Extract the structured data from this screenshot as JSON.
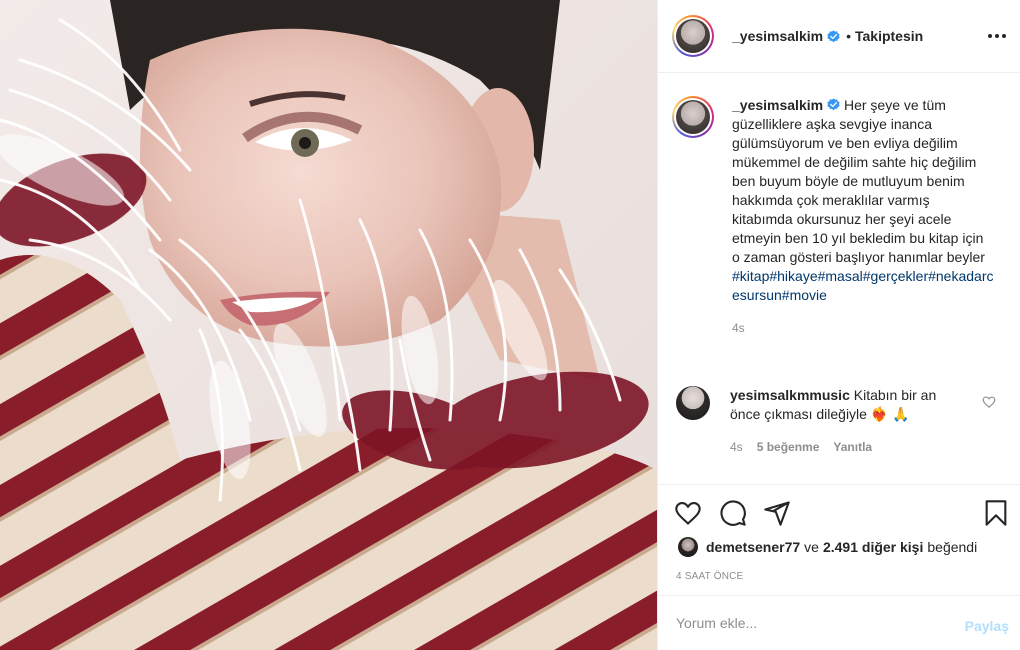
{
  "post": {
    "username": "_yesimsalkim",
    "follow_separator": "•",
    "follow_status": "Takiptesin",
    "more_icon": "more-horizontal-icon"
  },
  "caption": {
    "username": "_yesimsalkim",
    "text": "Her şeye ve tüm güzelliklere aşka sevgiye inanca gülümsüyorum ve ben evliya değilim mükemmel de değilim sahte hiç değilim ben buyum böyle de mutluyum benim hakkımda çok meraklılar varmış kitabımda okursunuz her şeyi acele etmeyin ben 10 yıl bekledim bu kitap için o zaman gösteri başlıyor hanımlar beyler",
    "hashtags": "#kitap#hikaye#masal#gerçekler#nekadarcesursun#movie",
    "time": "4s"
  },
  "comments": [
    {
      "username": "yesimsalkmmusic",
      "text": "Kitabın bir an önce çıkması dileğiyle",
      "emoji": "❤️‍🔥 🙏",
      "time": "4s",
      "likes": "5 beğenme",
      "reply": "Yanıtla"
    }
  ],
  "likes": {
    "user": "demetsener77",
    "connector": "ve",
    "count": "2.491 diğer kişi",
    "verb": "beğendi"
  },
  "posted_time": "4 SAAT ÖNCE",
  "comment_input": {
    "placeholder": "Yorum ekle...",
    "share_label": "Paylaş"
  },
  "colors": {
    "verified": "#3897f0",
    "hashtag": "#00376b",
    "muted": "#8e8e8e",
    "share_disabled": "#b2dffc"
  }
}
